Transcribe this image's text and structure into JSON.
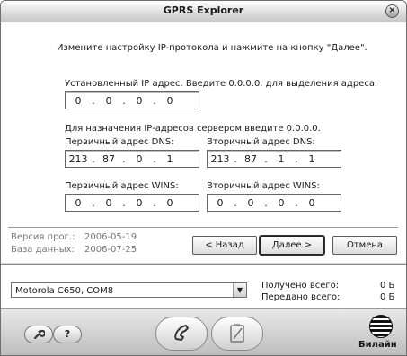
{
  "window": {
    "title": "GPRS Explorer",
    "close_glyph": "×"
  },
  "instruction": "Измените настройку IP-протокола и нажмите на кнопку \"Далее\".",
  "ip_section": {
    "label": "Установленный IP адрес. Введите 0.0.0.0. для выделения адреса.",
    "octets": [
      "0",
      "0",
      "0",
      "0"
    ]
  },
  "server_note": "Для назначения IP-адресов сервером введите 0.0.0.0.",
  "dns_primary": {
    "label": "Первичный адрес DNS:",
    "octets": [
      "213",
      "87",
      "0",
      "1"
    ]
  },
  "dns_secondary": {
    "label": "Вторичный адрес DNS:",
    "octets": [
      "213",
      "87",
      "1",
      "1"
    ]
  },
  "wins_primary": {
    "label": "Первичный адрес WINS:",
    "octets": [
      "0",
      "0",
      "0",
      "0"
    ]
  },
  "wins_secondary": {
    "label": "Вторичный адрес WINS:",
    "octets": [
      "0",
      "0",
      "0",
      "0"
    ]
  },
  "version": {
    "prog_label": "Версия прог.:",
    "prog_value": "2006-05-19",
    "db_label": "База данных:",
    "db_value": "2006-07-25"
  },
  "buttons": {
    "back": "< Назад",
    "next": "Далее >",
    "cancel": "Отмена"
  },
  "device": {
    "selected": "Motorola C650, COM8"
  },
  "stats": {
    "received_label": "Получено всего:",
    "received_value": "0 Б",
    "sent_label": "Передано всего:",
    "sent_value": "0 Б"
  },
  "toolbar": {
    "help_label": "?",
    "tools_icon": "wrench-icon",
    "call_icon": "phone-handset-icon",
    "disconnect_icon": "clipboard-icon"
  },
  "brand": {
    "name": "Билайн"
  }
}
